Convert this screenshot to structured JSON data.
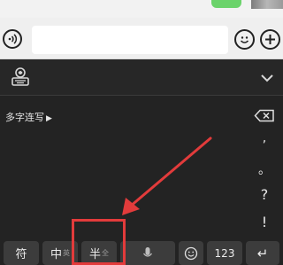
{
  "keyboard": {
    "mode_label": "多字连写",
    "punctuation": [
      ",",
      "。",
      "?",
      "!"
    ],
    "keys": {
      "symbol": "符",
      "chinese": "中",
      "chinese_sub": "英",
      "half_width": "半",
      "half_sub": "全",
      "numbers": "123",
      "enter": "↵"
    }
  },
  "annotation": {
    "color": "#e23b3b"
  }
}
